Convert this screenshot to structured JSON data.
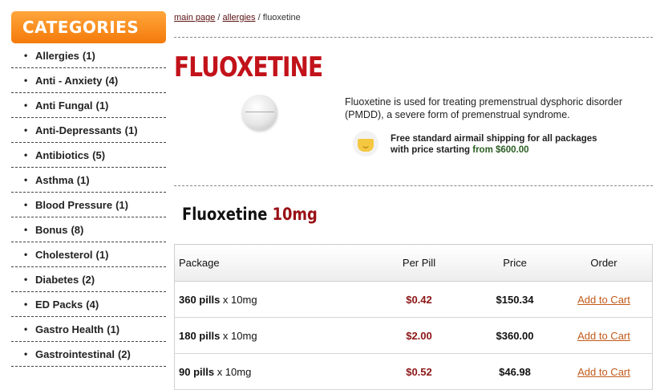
{
  "sidebar": {
    "header": "CATEGORIES",
    "items": [
      {
        "label": "Allergies",
        "count": "(1)"
      },
      {
        "label": "Anti - Anxiety",
        "count": "(4)"
      },
      {
        "label": "Anti Fungal",
        "count": "(1)"
      },
      {
        "label": "Anti-Depressants",
        "count": "(1)"
      },
      {
        "label": "Antibiotics",
        "count": "(5)"
      },
      {
        "label": "Asthma",
        "count": "(1)"
      },
      {
        "label": "Blood Pressure",
        "count": "(1)"
      },
      {
        "label": "Bonus",
        "count": "(8)"
      },
      {
        "label": "Cholesterol",
        "count": "(1)"
      },
      {
        "label": "Diabetes",
        "count": "(2)"
      },
      {
        "label": "ED Packs",
        "count": "(4)"
      },
      {
        "label": "Gastro Health",
        "count": "(1)"
      },
      {
        "label": "Gastrointestinal",
        "count": "(2)"
      }
    ]
  },
  "breadcrumb": {
    "home": "main page",
    "sep1": " / ",
    "category": "allergies",
    "sep2": " / ",
    "current": "fluoxetine"
  },
  "product": {
    "title": "FLUOXETINE",
    "description": "Fluoxetine is used for treating premenstrual dysphoric disorder (PMDD), a severe form of premenstrual syndrome.",
    "shipping_text": "Free standard airmail shipping for all packages with price starting ",
    "shipping_price": "from $600.00",
    "heading_name": "Fluoxetine ",
    "heading_dose": "10mg"
  },
  "table": {
    "headers": {
      "package": "Package",
      "per_pill": "Per Pill",
      "price": "Price",
      "order": "Order"
    },
    "rows": [
      {
        "pills": "360 pills",
        "dose": " x 10mg",
        "per_pill": "$0.42",
        "price": "$150.34",
        "action": "Add to Cart"
      },
      {
        "pills": "180 pills",
        "dose": " x 10mg",
        "per_pill": "$2.00",
        "price": "$360.00",
        "action": "Add to Cart"
      },
      {
        "pills": "90 pills",
        "dose": " x 10mg",
        "per_pill": "$0.52",
        "price": "$46.98",
        "action": "Add to Cart"
      }
    ]
  },
  "icons": {
    "pill": "pill-image",
    "shipping": "shipping-box-icon"
  },
  "colors": {
    "accent": "#f58a1f",
    "title": "#c2121a",
    "dose": "#9a1116",
    "link": "#c25a1a"
  }
}
